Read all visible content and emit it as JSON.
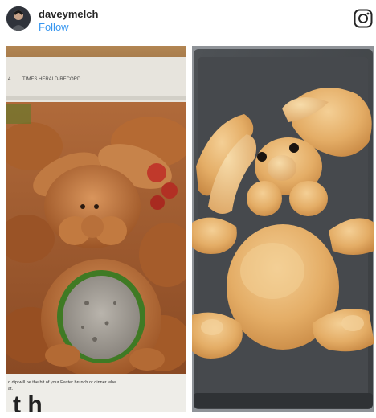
{
  "post": {
    "username": "daveymelch",
    "follow_label": "Follow",
    "icon": "instagram-icon"
  },
  "left_photo": {
    "newspaper_header": "TIMES HERALD-RECORD",
    "page_marker": "4",
    "caption_line1": "d dip will be the hit of your Easter brunch or dinner whe",
    "caption_line2": "at.",
    "headline_fragment": "t h"
  }
}
